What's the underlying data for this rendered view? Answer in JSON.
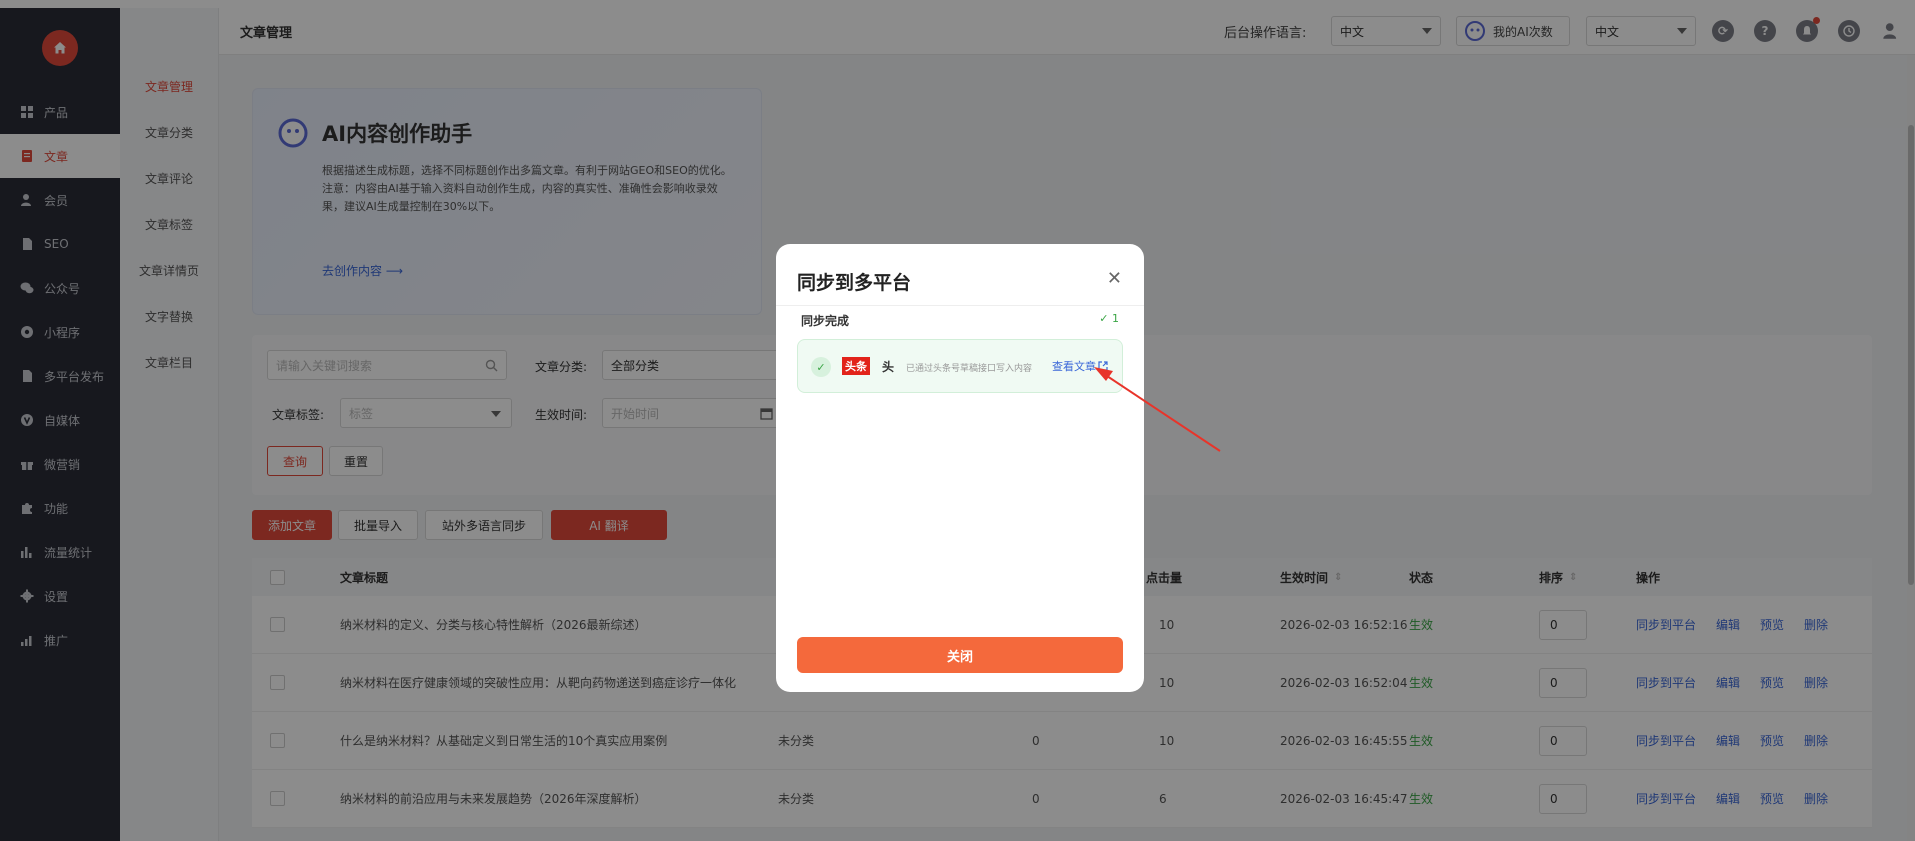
{
  "sidebar": {
    "items": [
      {
        "label": "产品",
        "icon": "grid-icon"
      },
      {
        "label": "文章",
        "icon": "document-icon",
        "active": true
      },
      {
        "label": "会员",
        "icon": "user-icon"
      },
      {
        "label": "SEO",
        "icon": "file-icon"
      },
      {
        "label": "公众号",
        "icon": "wechat-icon"
      },
      {
        "label": "小程序",
        "icon": "miniprogram-icon"
      },
      {
        "label": "多平台发布",
        "icon": "file-icon"
      },
      {
        "label": "自媒体",
        "icon": "v-icon"
      },
      {
        "label": "微营销",
        "icon": "gift-icon"
      },
      {
        "label": "功能",
        "icon": "puzzle-icon"
      },
      {
        "label": "流量统计",
        "icon": "bar-chart-icon"
      },
      {
        "label": "设置",
        "icon": "gear-icon"
      },
      {
        "label": "推广",
        "icon": "chart-icon"
      }
    ]
  },
  "subnav": {
    "items": [
      "文章管理",
      "文章分类",
      "文章评论",
      "文章标签",
      "文章详情页",
      "文字替换",
      "文章栏目"
    ]
  },
  "topbar": {
    "title": "文章管理",
    "lang_label": "后台操作语言:",
    "lang_value": "中文",
    "ai_count_label": "我的AI次数",
    "lang2_value": "中文"
  },
  "ai_card": {
    "title": "AI内容创作助手",
    "desc1": "根据描述生成标题，选择不同标题创作出多篇文章。有利于网站GEO和SEO的优化。",
    "desc2": "注意：内容由AI基于输入资料自动创作生成，内容的真实性、准确性会影响收录效果，建议AI生成量控制在30%以下。",
    "link": "去创作内容 ⟶"
  },
  "filter": {
    "keyword_placeholder": "请输入关键词搜索",
    "category_label": "文章分类:",
    "category_value": "全部分类",
    "tag_label": "文章标签:",
    "tag_placeholder": "标签",
    "time_label": "生效时间:",
    "time_placeholder": "开始时间",
    "query": "查询",
    "reset": "重置"
  },
  "actions": {
    "add": "添加文章",
    "import": "批量导入",
    "multi_lang": "站外多语言同步",
    "ai_translate": "AI 翻译"
  },
  "table": {
    "headers": {
      "title": "文章标题",
      "clicks": "点击量",
      "time": "生效时间",
      "status": "状态",
      "sort": "排序",
      "ops": "操作"
    },
    "rows": [
      {
        "title": "纳米材料的定义、分类与核心特性解析（2026最新综述）",
        "category": "",
        "comments": "",
        "clicks": "10",
        "time": "2026-02-03 16:52:16",
        "status": "生效",
        "sort": "0"
      },
      {
        "title": "纳米材料在医疗健康领域的突破性应用：从靶向药物递送到癌症诊疗一体化",
        "category": "",
        "comments": "",
        "clicks": "10",
        "time": "2026-02-03 16:52:04",
        "status": "生效",
        "sort": "0"
      },
      {
        "title": "什么是纳米材料？从基础定义到日常生活的10个真实应用案例",
        "category": "未分类",
        "comments": "0",
        "clicks": "10",
        "time": "2026-02-03 16:45:55",
        "status": "生效",
        "sort": "0"
      },
      {
        "title": "纳米材料的前沿应用与未来发展趋势（2026年深度解析）",
        "category": "未分类",
        "comments": "0",
        "clicks": "6",
        "time": "2026-02-03 16:45:47",
        "status": "生效",
        "sort": "0"
      }
    ],
    "ops": [
      "同步到平台",
      "编辑",
      "预览",
      "删除"
    ]
  },
  "modal": {
    "title": "同步到多平台",
    "done_label": "同步完成",
    "done_count": "✓ 1",
    "platform_logo": "头条",
    "platform_name": "头",
    "platform_desc": "已通过头条号草稿接口写入内容",
    "view_link": "查看文章",
    "close_button": "关闭"
  },
  "colors": {
    "accent": "#e24a3b",
    "sidebar_bg": "#2a2d38",
    "link": "#3a67d8",
    "success": "#3aa545",
    "modal_button": "#f4693c"
  }
}
